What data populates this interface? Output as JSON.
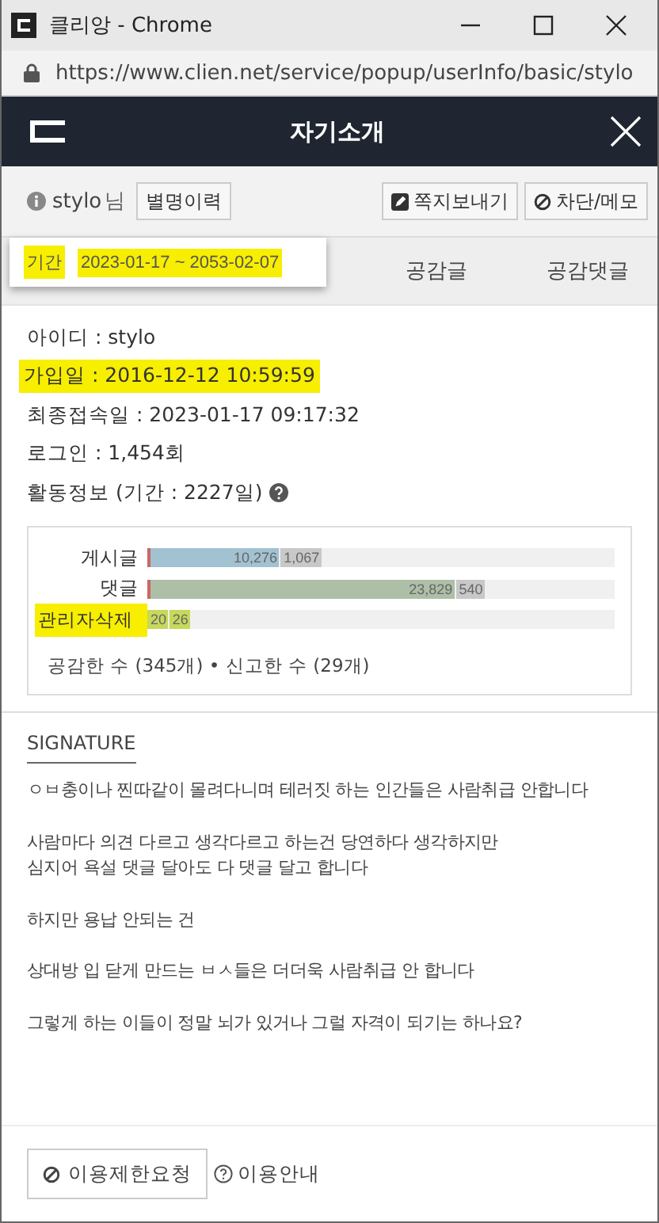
{
  "window": {
    "title": "클리앙 - Chrome",
    "url": "https://www.clien.net/service/popup/userInfo/basic/stylo"
  },
  "header": {
    "title": "자기소개"
  },
  "user": {
    "name": "stylo",
    "suffix": "님",
    "buttons": [
      {
        "label": "별명이력",
        "kind": "plain"
      },
      {
        "label": "쪽지보내기",
        "kind": "message"
      },
      {
        "label": "차단/메모",
        "kind": "block"
      }
    ]
  },
  "tabs": [
    {
      "label": "공감글"
    },
    {
      "label": "공감댓글"
    }
  ],
  "period_popup": {
    "label": "기간",
    "value": "2023-01-17 ~ 2053-02-07",
    "highlighted": true
  },
  "info": [
    {
      "text": "아이디 : stylo",
      "highlighted": false
    },
    {
      "text": "가입일 : 2016-12-12 10:59:59",
      "highlighted": true
    },
    {
      "text": "최종접속일 : 2023-01-17 09:17:32",
      "highlighted": false
    },
    {
      "text": "로그인 : 1,454회",
      "highlighted": false
    }
  ],
  "activity": {
    "title": "활동정보 (기간 : 2227일)",
    "bars": [
      {
        "label": "게시글",
        "highlighted": false,
        "segments": [
          {
            "text": "10,276",
            "level": 0.285,
            "color": "#a2c1d1"
          },
          {
            "text": "1,067",
            "color": "#c8c8c8"
          }
        ]
      },
      {
        "label": "댓글",
        "highlighted": false,
        "segments": [
          {
            "text": "23,829",
            "level": 0.66,
            "color": "#adbfa6"
          },
          {
            "text": "540",
            "color": "#c8c8c8"
          }
        ]
      },
      {
        "label": "관리자삭제",
        "highlighted": true,
        "segments": [
          {
            "text": "20",
            "level": 0.047,
            "color": "#c7d85a"
          },
          {
            "text": "26",
            "color": "#c7d85a"
          }
        ]
      }
    ],
    "summary": "공감한 수 (345개) • 신고한 수 (29개)"
  },
  "signature": {
    "title": "SIGNATURE",
    "paragraphs": [
      "ㅇㅂ충이나 찐따같이 몰려다니며 테러짓 하는 인간들은 사람취급 안합니다",
      "사람마다 의견 다르고 생각다르고 하는건 당연하다 생각하지만\n심지어 욕설 댓글 달아도 다 댓글 달고 합니다",
      "하지만 용납 안되는 건",
      "상대방 입 닫게 만드는 ㅂㅅ들은 더더욱 사람취급 안 합니다",
      "그렇게 하는 이들이 정말 뇌가 있거나 그럴 자격이 되기는 하나요?"
    ]
  },
  "footer": {
    "report_button": "이용제한요청",
    "guide_link": "이용안내"
  }
}
